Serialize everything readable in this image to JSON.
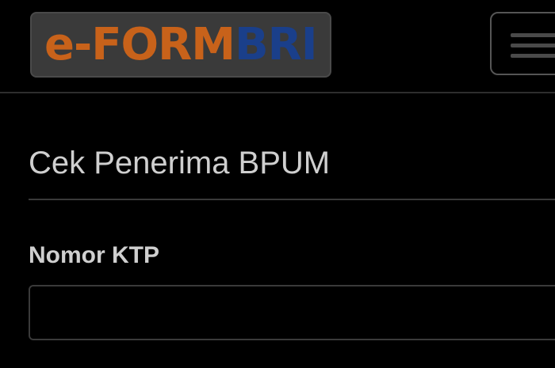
{
  "header": {
    "logo": {
      "text_part1": "e-FORM",
      "text_part2": "BRI",
      "color_part1": "#c8621a",
      "color_part2": "#1a3f8a"
    },
    "menu_icon": "hamburger-menu-icon"
  },
  "main": {
    "title": "Cek Penerima BPUM",
    "ktp_field": {
      "label": "Nomor KTP",
      "value": "",
      "placeholder": ""
    }
  },
  "theme": {
    "background": "#000000",
    "text": "#cfcfcf",
    "border": "#3a3a3a"
  }
}
